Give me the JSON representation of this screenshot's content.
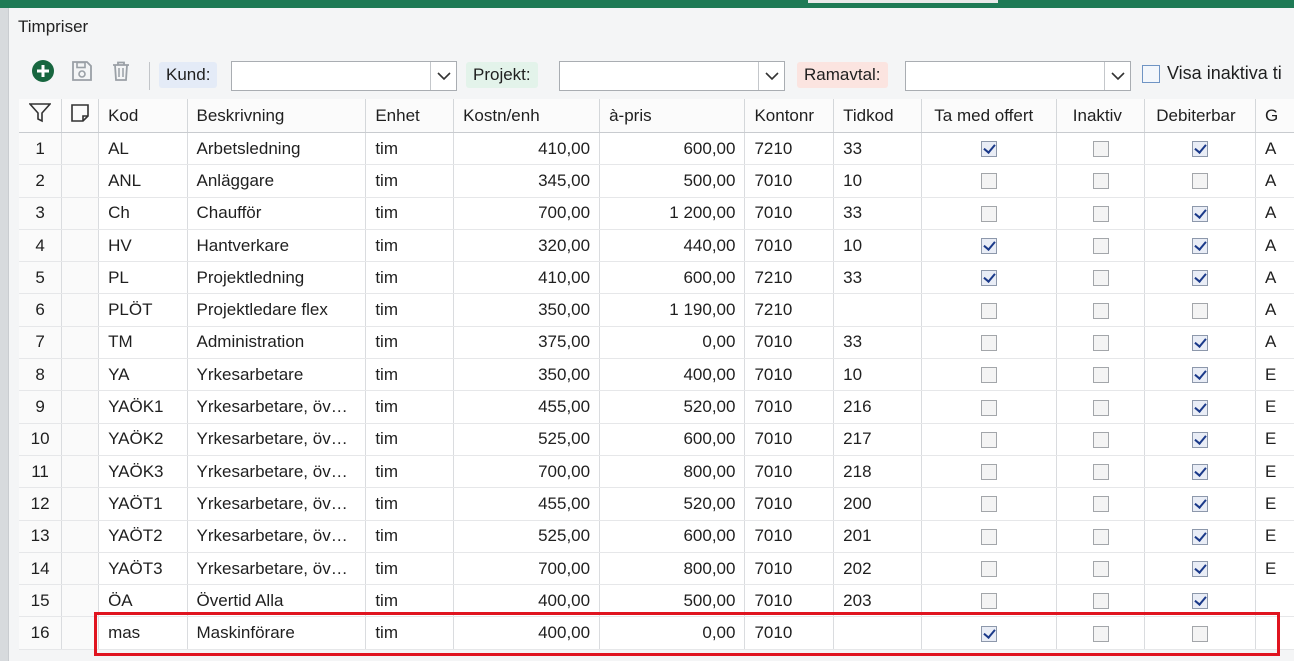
{
  "window": {
    "title": "Timpriser"
  },
  "toolbar": {
    "add_icon": "plus-circle-icon",
    "save_icon": "floppy-disk-icon",
    "delete_icon": "trash-icon",
    "kund_label": "Kund:",
    "kund_value": "",
    "projekt_label": "Projekt:",
    "projekt_value": "",
    "ramavtal_label": "Ramavtal:",
    "ramavtal_value": "",
    "show_inactive_label": "Visa inaktiva ti",
    "show_inactive_checked": false
  },
  "colors": {
    "kund_label_bg": "#e4ebf7",
    "projekt_label_bg": "#e3f3ea",
    "ramavtal_label_bg": "#fbe4e0",
    "highlight": "#e0141f"
  },
  "table": {
    "columns": [
      "Kod",
      "Beskrivning",
      "Enhet",
      "Kostn/enh",
      "à-pris",
      "Kontonr",
      "Tidkod",
      "Ta med offert",
      "Inaktiv",
      "Debiterbar",
      "G"
    ],
    "rows": [
      {
        "n": "1",
        "kod": "AL",
        "besk": "Arbetsledning",
        "enhet": "tim",
        "kostn": "410,00",
        "apris": "600,00",
        "konto": "7210",
        "tidkod": "33",
        "offert": true,
        "inaktiv": false,
        "debit": true,
        "g": "A"
      },
      {
        "n": "2",
        "kod": "ANL",
        "besk": "Anläggare",
        "enhet": "tim",
        "kostn": "345,00",
        "apris": "500,00",
        "konto": "7010",
        "tidkod": "10",
        "offert": false,
        "inaktiv": false,
        "debit": false,
        "g": "A"
      },
      {
        "n": "3",
        "kod": "Ch",
        "besk": "Chaufför",
        "enhet": "tim",
        "kostn": "700,00",
        "apris": "1 200,00",
        "konto": "7010",
        "tidkod": "33",
        "offert": false,
        "inaktiv": false,
        "debit": true,
        "g": "A"
      },
      {
        "n": "4",
        "kod": "HV",
        "besk": "Hantverkare",
        "enhet": "tim",
        "kostn": "320,00",
        "apris": "440,00",
        "konto": "7010",
        "tidkod": "10",
        "offert": true,
        "inaktiv": false,
        "debit": true,
        "g": "A"
      },
      {
        "n": "5",
        "kod": "PL",
        "besk": "Projektledning",
        "enhet": "tim",
        "kostn": "410,00",
        "apris": "600,00",
        "konto": "7210",
        "tidkod": "33",
        "offert": true,
        "inaktiv": false,
        "debit": true,
        "g": "A"
      },
      {
        "n": "6",
        "kod": "PLÖT",
        "besk": "Projektledare flex",
        "enhet": "tim",
        "kostn": "350,00",
        "apris": "1 190,00",
        "konto": "7210",
        "tidkod": "",
        "offert": false,
        "inaktiv": false,
        "debit": false,
        "g": "A"
      },
      {
        "n": "7",
        "kod": "TM",
        "besk": "Administration",
        "enhet": "tim",
        "kostn": "375,00",
        "apris": "0,00",
        "konto": "7010",
        "tidkod": "33",
        "offert": false,
        "inaktiv": false,
        "debit": true,
        "g": "A"
      },
      {
        "n": "8",
        "kod": "YA",
        "besk": "Yrkesarbetare",
        "enhet": "tim",
        "kostn": "350,00",
        "apris": "400,00",
        "konto": "7010",
        "tidkod": "10",
        "offert": false,
        "inaktiv": false,
        "debit": true,
        "g": "E"
      },
      {
        "n": "9",
        "kod": "YAÖK1",
        "besk": "Yrkesarbetare, öv…",
        "enhet": "tim",
        "kostn": "455,00",
        "apris": "520,00",
        "konto": "7010",
        "tidkod": "216",
        "offert": false,
        "inaktiv": false,
        "debit": true,
        "g": "E"
      },
      {
        "n": "10",
        "kod": "YAÖK2",
        "besk": "Yrkesarbetare, öv…",
        "enhet": "tim",
        "kostn": "525,00",
        "apris": "600,00",
        "konto": "7010",
        "tidkod": "217",
        "offert": false,
        "inaktiv": false,
        "debit": true,
        "g": "E"
      },
      {
        "n": "11",
        "kod": "YAÖK3",
        "besk": "Yrkesarbetare, öv…",
        "enhet": "tim",
        "kostn": "700,00",
        "apris": "800,00",
        "konto": "7010",
        "tidkod": "218",
        "offert": false,
        "inaktiv": false,
        "debit": true,
        "g": "E"
      },
      {
        "n": "12",
        "kod": "YAÖT1",
        "besk": "Yrkesarbetare, öv…",
        "enhet": "tim",
        "kostn": "455,00",
        "apris": "520,00",
        "konto": "7010",
        "tidkod": "200",
        "offert": false,
        "inaktiv": false,
        "debit": true,
        "g": "E"
      },
      {
        "n": "13",
        "kod": "YAÖT2",
        "besk": "Yrkesarbetare, öv…",
        "enhet": "tim",
        "kostn": "525,00",
        "apris": "600,00",
        "konto": "7010",
        "tidkod": "201",
        "offert": false,
        "inaktiv": false,
        "debit": true,
        "g": "E"
      },
      {
        "n": "14",
        "kod": "YAÖT3",
        "besk": "Yrkesarbetare, öv…",
        "enhet": "tim",
        "kostn": "700,00",
        "apris": "800,00",
        "konto": "7010",
        "tidkod": "202",
        "offert": false,
        "inaktiv": false,
        "debit": true,
        "g": "E"
      },
      {
        "n": "15",
        "kod": "ÖA",
        "besk": "Övertid Alla",
        "enhet": "tim",
        "kostn": "400,00",
        "apris": "500,00",
        "konto": "7010",
        "tidkod": "203",
        "offert": false,
        "inaktiv": false,
        "debit": true,
        "g": ""
      },
      {
        "n": "16",
        "kod": "mas",
        "besk": "Maskinförare",
        "enhet": "tim",
        "kostn": "400,00",
        "apris": "0,00",
        "konto": "7010",
        "tidkod": "",
        "offert": true,
        "inaktiv": false,
        "debit": false,
        "g": ""
      }
    ]
  }
}
